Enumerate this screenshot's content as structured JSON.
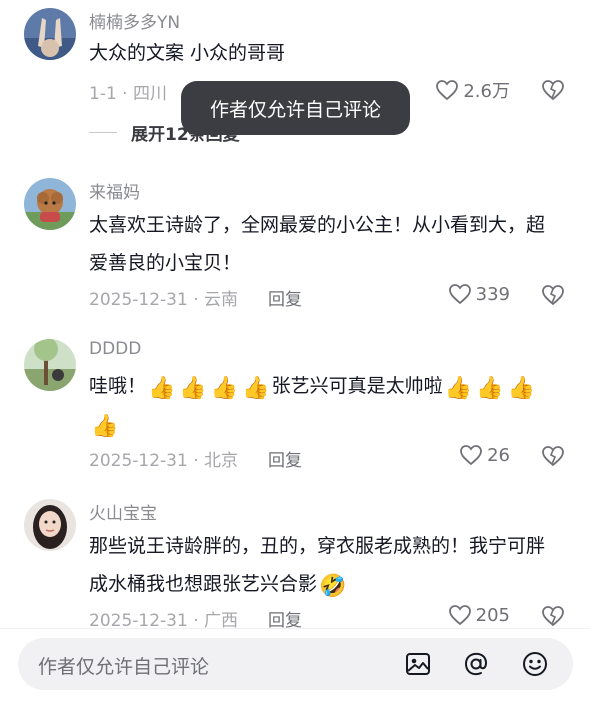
{
  "tooltip": {
    "text": "作者仅允许自己评论"
  },
  "comments": [
    {
      "username": "楠楠多多YN",
      "text": "大众的文案 小众的哥哥",
      "meta": "1-1 · 四川",
      "likes": "2.6万",
      "liked": false,
      "avatar": "avatar-photo",
      "expand_label": "展开12条回复"
    },
    {
      "username": "来福妈",
      "text": "太喜欢王诗龄了，全网最爱的小公主！从小看到大，超爱善良的小宝贝！",
      "meta": "2025-12-31 · 云南",
      "reply_label": "回复",
      "likes": "339",
      "avatar": "avatar-dog"
    },
    {
      "username": "DDDD",
      "text_parts": [
        "哇哦！",
        "张艺兴可真是太帅啦"
      ],
      "emoji": {
        "thumbs": "👍"
      },
      "meta": "2025-12-31 · 北京",
      "reply_label": "回复",
      "likes": "26",
      "avatar": "avatar-outdoor"
    },
    {
      "username": "火山宝宝",
      "text": "那些说王诗龄胖的，丑的，穿衣服老成熟的！我宁可胖成水桶我也想跟张艺兴合影",
      "emoji": {
        "laughing": "🤣"
      },
      "meta": "2025-12-31 · 广西",
      "reply_label": "回复",
      "likes": "205",
      "avatar": "avatar-girl"
    }
  ],
  "input": {
    "placeholder": "作者仅允许自己评论"
  },
  "icons": {
    "like": "heart-outline-icon",
    "dislike": "broken-heart-icon",
    "image": "image-icon",
    "mention": "at-icon",
    "emoji": "smiley-icon"
  },
  "colors": {
    "text": "#161823",
    "secondary": "#8a8b91",
    "tooltip_bg": "#3c3d42",
    "input_bg": "#f1f1f3"
  }
}
